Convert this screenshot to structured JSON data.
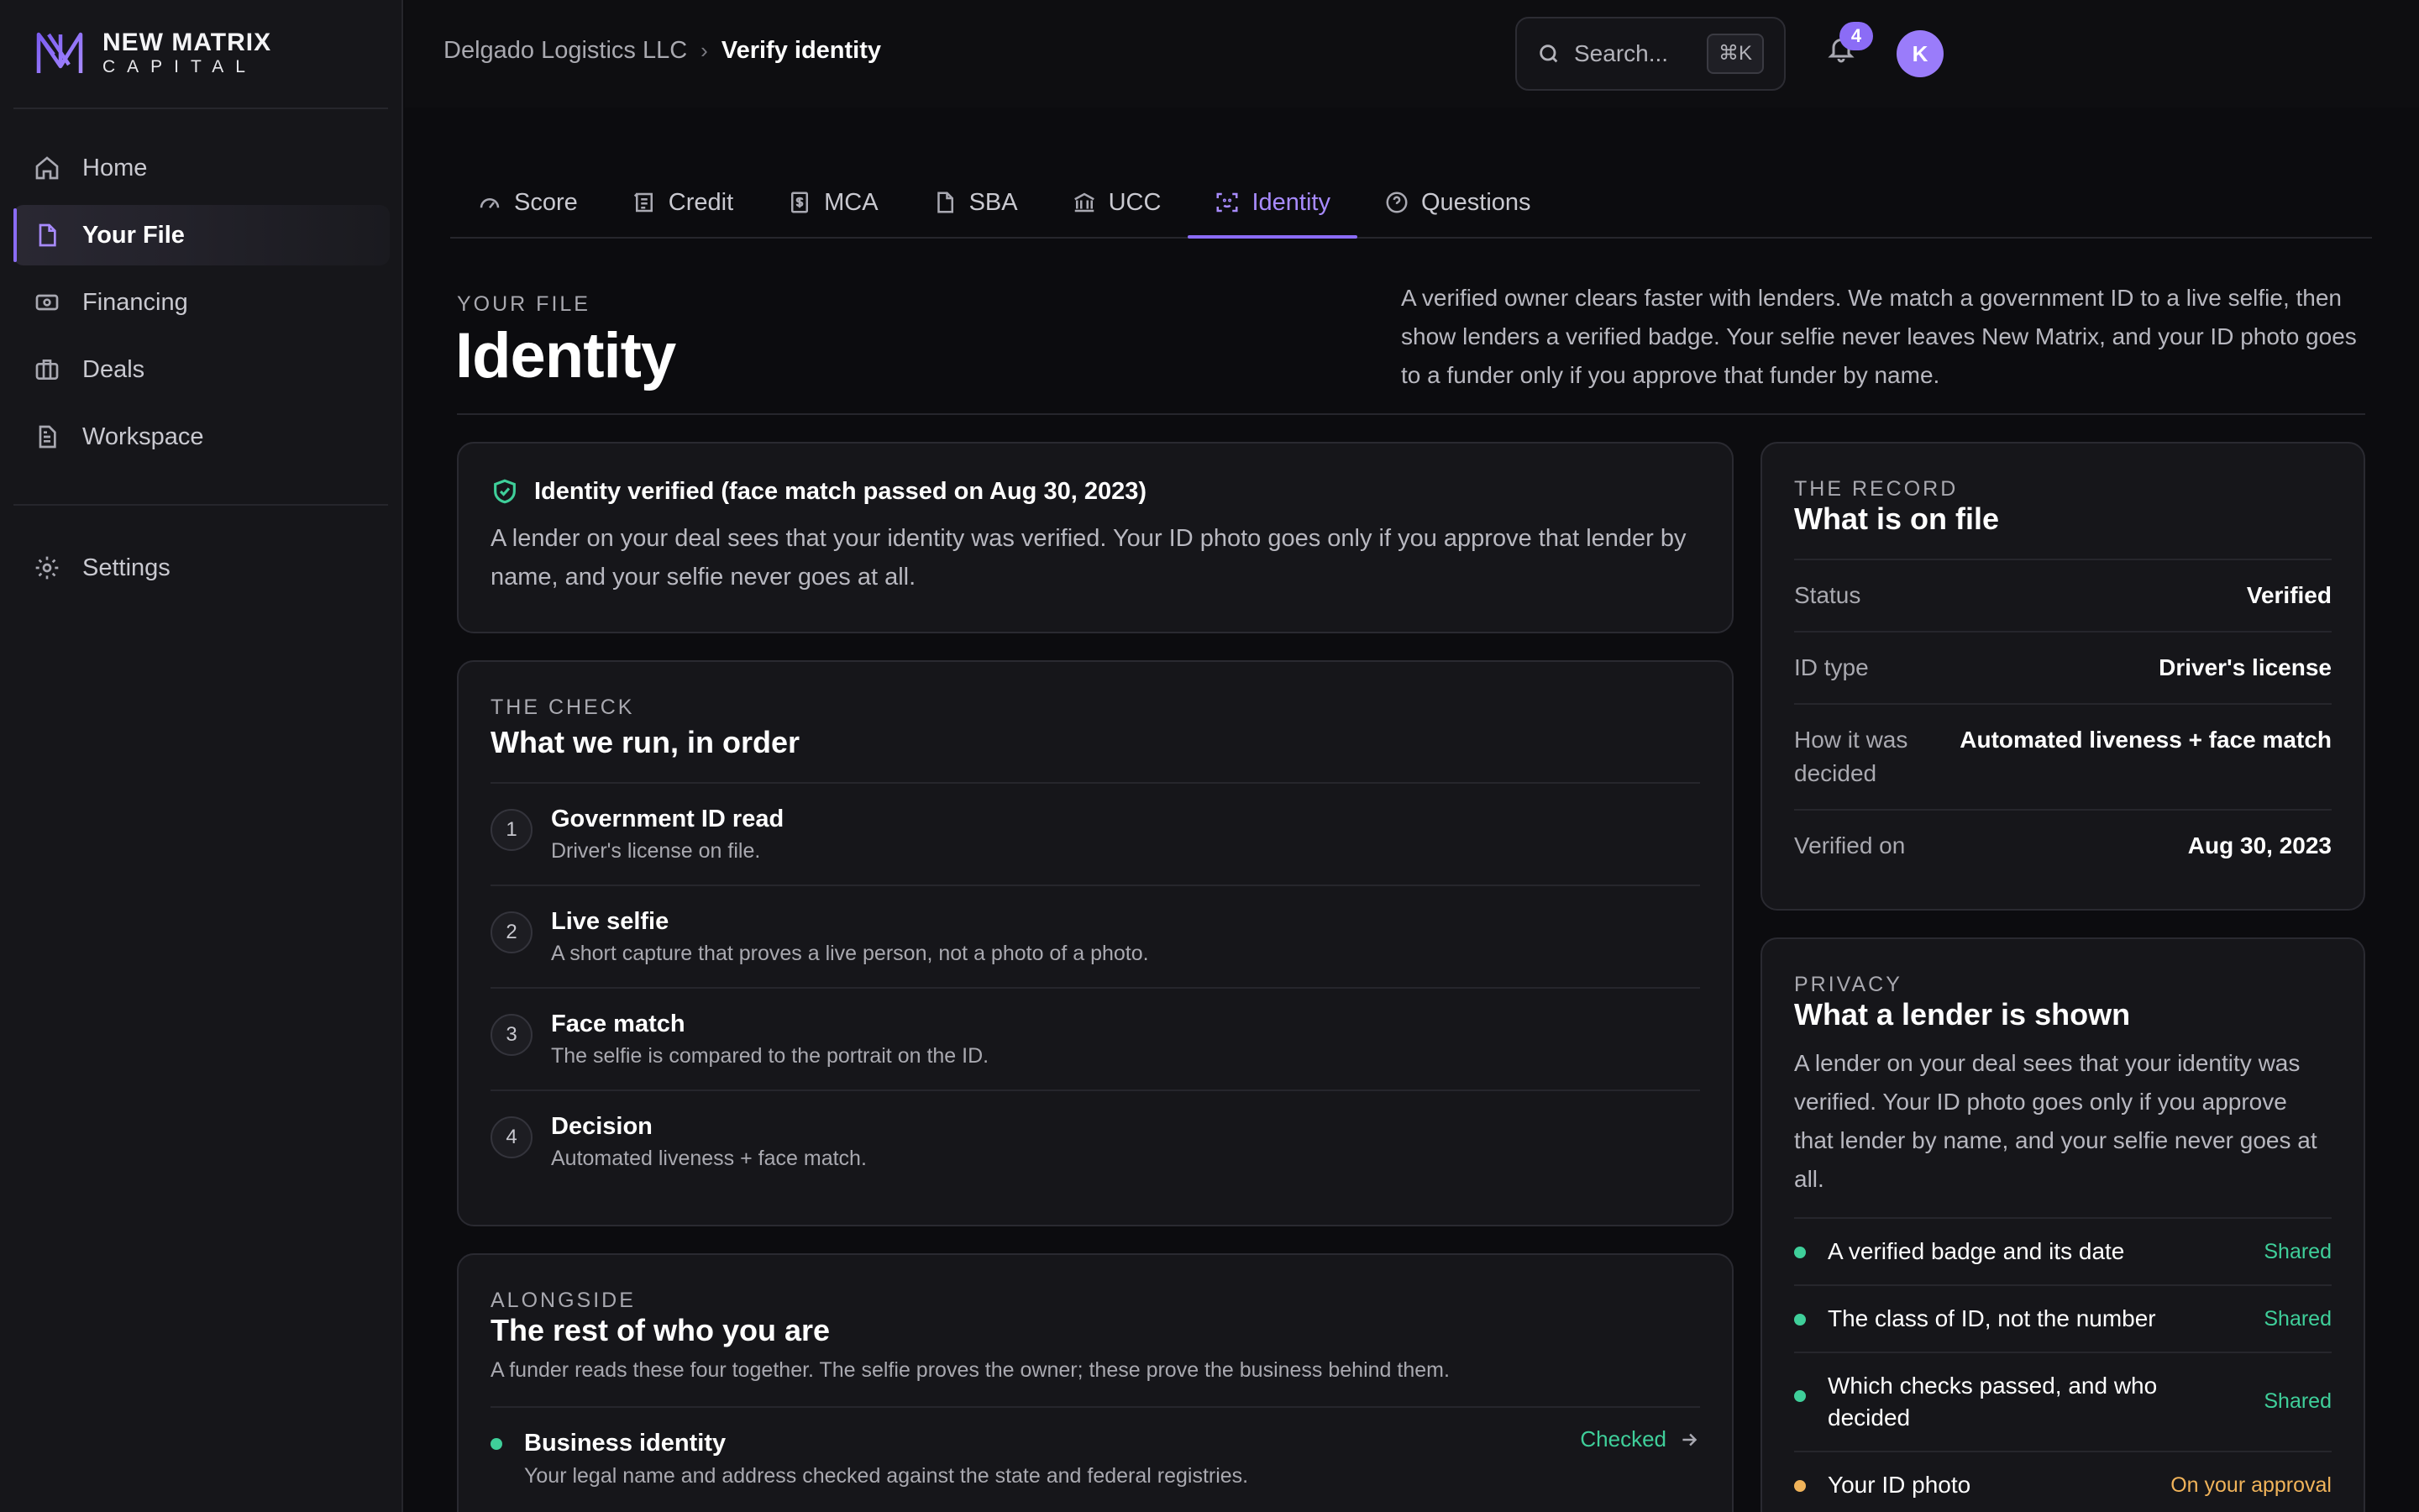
{
  "brand": {
    "name_line1": "NEW MATRIX",
    "name_line2": "CAPITAL",
    "accent": "#8b6cf6"
  },
  "sidebar": {
    "items": [
      {
        "label": "Home",
        "icon": "home-icon"
      },
      {
        "label": "Your File",
        "icon": "file-icon",
        "active": true
      },
      {
        "label": "Financing",
        "icon": "cash-icon"
      },
      {
        "label": "Deals",
        "icon": "briefcase-icon"
      },
      {
        "label": "Workspace",
        "icon": "document-icon"
      }
    ],
    "settings": {
      "label": "Settings",
      "icon": "gear-icon"
    }
  },
  "topbar": {
    "breadcrumb": [
      "Delgado Logistics LLC",
      "Verify identity"
    ],
    "search_placeholder": "Search...",
    "search_shortcut": "⌘K",
    "notification_count": "4",
    "avatar_initial": "K"
  },
  "tabs": [
    {
      "label": "Score",
      "icon": "gauge-icon"
    },
    {
      "label": "Credit",
      "icon": "receipt-icon"
    },
    {
      "label": "MCA",
      "icon": "dollar-doc-icon"
    },
    {
      "label": "SBA",
      "icon": "doc-icon"
    },
    {
      "label": "UCC",
      "icon": "bank-icon"
    },
    {
      "label": "Identity",
      "icon": "face-scan-icon",
      "active": true
    },
    {
      "label": "Questions",
      "icon": "help-circle-icon"
    }
  ],
  "header": {
    "eyebrow": "YOUR FILE",
    "title": "Identity",
    "description": "A verified owner clears faster with lenders. We match a government ID to a live selfie, then show lenders a verified badge. Your selfie never leaves New Matrix, and your ID photo goes to a funder only if you approve that funder by name."
  },
  "verified": {
    "title": "Identity verified (face match passed on Aug 30, 2023)",
    "body": "A lender on your deal sees that your identity was verified. Your ID photo goes only if you approve that lender by name, and your selfie never goes at all."
  },
  "check": {
    "eyebrow": "THE CHECK",
    "title": "What we run, in order",
    "steps": [
      {
        "num": "1",
        "title": "Government ID read",
        "desc": "Driver's license on file."
      },
      {
        "num": "2",
        "title": "Live selfie",
        "desc": "A short capture that proves a live person, not a photo of a photo."
      },
      {
        "num": "3",
        "title": "Face match",
        "desc": "The selfie is compared to the portrait on the ID."
      },
      {
        "num": "4",
        "title": "Decision",
        "desc": "Automated liveness + face match."
      }
    ]
  },
  "alongside": {
    "eyebrow": "ALONGSIDE",
    "title": "The rest of who you are",
    "sub": "A funder reads these four together. The selfie proves the owner; these prove the business behind them.",
    "rows": [
      {
        "title": "Business identity",
        "desc": "Your legal name and address checked against the state and federal registries.",
        "status": "Checked"
      }
    ]
  },
  "record": {
    "eyebrow": "THE RECORD",
    "title": "What is on file",
    "rows": [
      {
        "k": "Status",
        "v": "Verified"
      },
      {
        "k": "ID type",
        "v": "Driver's license"
      },
      {
        "k": "How it was decided",
        "v": "Automated liveness + face match"
      },
      {
        "k": "Verified on",
        "v": "Aug 30, 2023"
      }
    ]
  },
  "privacy": {
    "eyebrow": "PRIVACY",
    "title": "What a lender is shown",
    "body": "A lender on your deal sees that your identity was verified. Your ID photo goes only if you approve that lender by name, and your selfie never goes at all.",
    "items": [
      {
        "label": "A verified badge and its date",
        "state": "Shared"
      },
      {
        "label": "The class of ID, not the number",
        "state": "Shared"
      },
      {
        "label": "Which checks passed, and who decided",
        "state": "Shared"
      },
      {
        "label": "Your ID photo",
        "state": "On your approval"
      }
    ]
  },
  "colors": {
    "success": "#3fcf9a",
    "warning": "#f0b35a"
  }
}
